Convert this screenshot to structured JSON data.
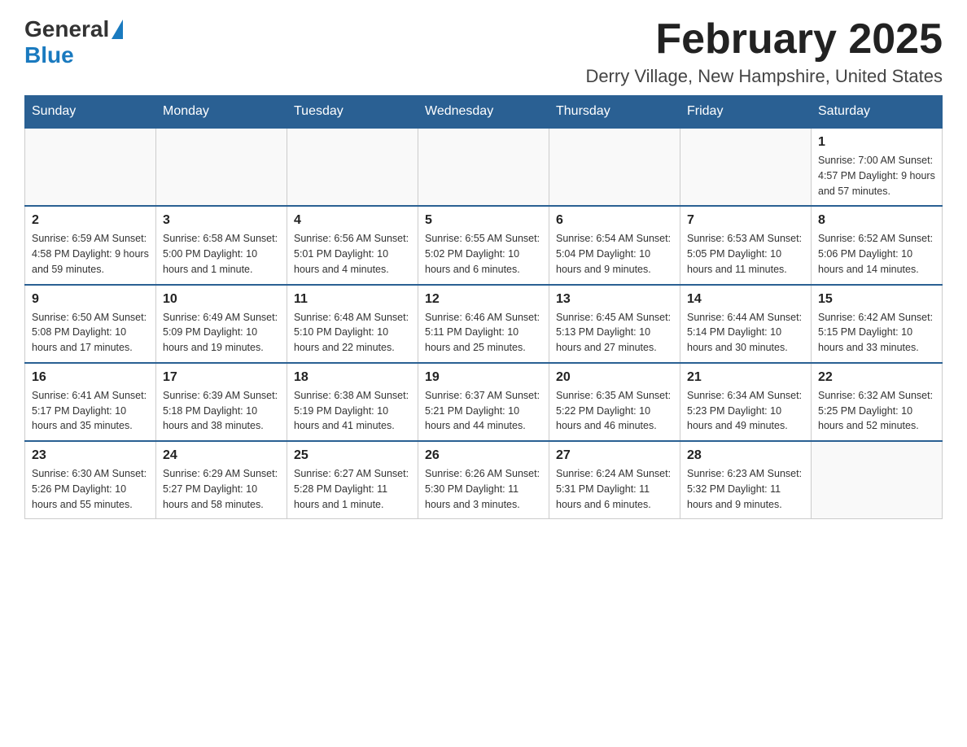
{
  "header": {
    "logo_general": "General",
    "logo_blue": "Blue",
    "month_title": "February 2025",
    "location": "Derry Village, New Hampshire, United States"
  },
  "days_of_week": [
    "Sunday",
    "Monday",
    "Tuesday",
    "Wednesday",
    "Thursday",
    "Friday",
    "Saturday"
  ],
  "weeks": [
    [
      {
        "day": "",
        "info": ""
      },
      {
        "day": "",
        "info": ""
      },
      {
        "day": "",
        "info": ""
      },
      {
        "day": "",
        "info": ""
      },
      {
        "day": "",
        "info": ""
      },
      {
        "day": "",
        "info": ""
      },
      {
        "day": "1",
        "info": "Sunrise: 7:00 AM\nSunset: 4:57 PM\nDaylight: 9 hours and 57 minutes."
      }
    ],
    [
      {
        "day": "2",
        "info": "Sunrise: 6:59 AM\nSunset: 4:58 PM\nDaylight: 9 hours and 59 minutes."
      },
      {
        "day": "3",
        "info": "Sunrise: 6:58 AM\nSunset: 5:00 PM\nDaylight: 10 hours and 1 minute."
      },
      {
        "day": "4",
        "info": "Sunrise: 6:56 AM\nSunset: 5:01 PM\nDaylight: 10 hours and 4 minutes."
      },
      {
        "day": "5",
        "info": "Sunrise: 6:55 AM\nSunset: 5:02 PM\nDaylight: 10 hours and 6 minutes."
      },
      {
        "day": "6",
        "info": "Sunrise: 6:54 AM\nSunset: 5:04 PM\nDaylight: 10 hours and 9 minutes."
      },
      {
        "day": "7",
        "info": "Sunrise: 6:53 AM\nSunset: 5:05 PM\nDaylight: 10 hours and 11 minutes."
      },
      {
        "day": "8",
        "info": "Sunrise: 6:52 AM\nSunset: 5:06 PM\nDaylight: 10 hours and 14 minutes."
      }
    ],
    [
      {
        "day": "9",
        "info": "Sunrise: 6:50 AM\nSunset: 5:08 PM\nDaylight: 10 hours and 17 minutes."
      },
      {
        "day": "10",
        "info": "Sunrise: 6:49 AM\nSunset: 5:09 PM\nDaylight: 10 hours and 19 minutes."
      },
      {
        "day": "11",
        "info": "Sunrise: 6:48 AM\nSunset: 5:10 PM\nDaylight: 10 hours and 22 minutes."
      },
      {
        "day": "12",
        "info": "Sunrise: 6:46 AM\nSunset: 5:11 PM\nDaylight: 10 hours and 25 minutes."
      },
      {
        "day": "13",
        "info": "Sunrise: 6:45 AM\nSunset: 5:13 PM\nDaylight: 10 hours and 27 minutes."
      },
      {
        "day": "14",
        "info": "Sunrise: 6:44 AM\nSunset: 5:14 PM\nDaylight: 10 hours and 30 minutes."
      },
      {
        "day": "15",
        "info": "Sunrise: 6:42 AM\nSunset: 5:15 PM\nDaylight: 10 hours and 33 minutes."
      }
    ],
    [
      {
        "day": "16",
        "info": "Sunrise: 6:41 AM\nSunset: 5:17 PM\nDaylight: 10 hours and 35 minutes."
      },
      {
        "day": "17",
        "info": "Sunrise: 6:39 AM\nSunset: 5:18 PM\nDaylight: 10 hours and 38 minutes."
      },
      {
        "day": "18",
        "info": "Sunrise: 6:38 AM\nSunset: 5:19 PM\nDaylight: 10 hours and 41 minutes."
      },
      {
        "day": "19",
        "info": "Sunrise: 6:37 AM\nSunset: 5:21 PM\nDaylight: 10 hours and 44 minutes."
      },
      {
        "day": "20",
        "info": "Sunrise: 6:35 AM\nSunset: 5:22 PM\nDaylight: 10 hours and 46 minutes."
      },
      {
        "day": "21",
        "info": "Sunrise: 6:34 AM\nSunset: 5:23 PM\nDaylight: 10 hours and 49 minutes."
      },
      {
        "day": "22",
        "info": "Sunrise: 6:32 AM\nSunset: 5:25 PM\nDaylight: 10 hours and 52 minutes."
      }
    ],
    [
      {
        "day": "23",
        "info": "Sunrise: 6:30 AM\nSunset: 5:26 PM\nDaylight: 10 hours and 55 minutes."
      },
      {
        "day": "24",
        "info": "Sunrise: 6:29 AM\nSunset: 5:27 PM\nDaylight: 10 hours and 58 minutes."
      },
      {
        "day": "25",
        "info": "Sunrise: 6:27 AM\nSunset: 5:28 PM\nDaylight: 11 hours and 1 minute."
      },
      {
        "day": "26",
        "info": "Sunrise: 6:26 AM\nSunset: 5:30 PM\nDaylight: 11 hours and 3 minutes."
      },
      {
        "day": "27",
        "info": "Sunrise: 6:24 AM\nSunset: 5:31 PM\nDaylight: 11 hours and 6 minutes."
      },
      {
        "day": "28",
        "info": "Sunrise: 6:23 AM\nSunset: 5:32 PM\nDaylight: 11 hours and 9 minutes."
      },
      {
        "day": "",
        "info": ""
      }
    ]
  ]
}
